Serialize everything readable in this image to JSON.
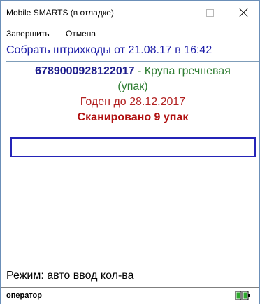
{
  "window": {
    "title": "Mobile SMARTS (в отладке)"
  },
  "menu": {
    "finish": "Завершить",
    "cancel": "Отмена"
  },
  "document": {
    "header": "Собрать штрихкоды от 21.08.17 в 16:42"
  },
  "product": {
    "barcode": "6789000928122017",
    "separator": "-",
    "name": "Крупа гречневая",
    "unit": "(упак)",
    "expiry": "Годен до 28.12.2017",
    "scanned": "Сканировано 9 упак"
  },
  "scan_field": {
    "value": "",
    "placeholder": ""
  },
  "mode": {
    "label": "Режим: авто ввод кол-ва"
  },
  "status": {
    "user": "оператор",
    "battery_icon": "battery-icon"
  },
  "colors": {
    "header_blue": "#1c1ca8",
    "green": "#2e7d32",
    "red": "#b01010",
    "input_border": "#2424b8"
  }
}
